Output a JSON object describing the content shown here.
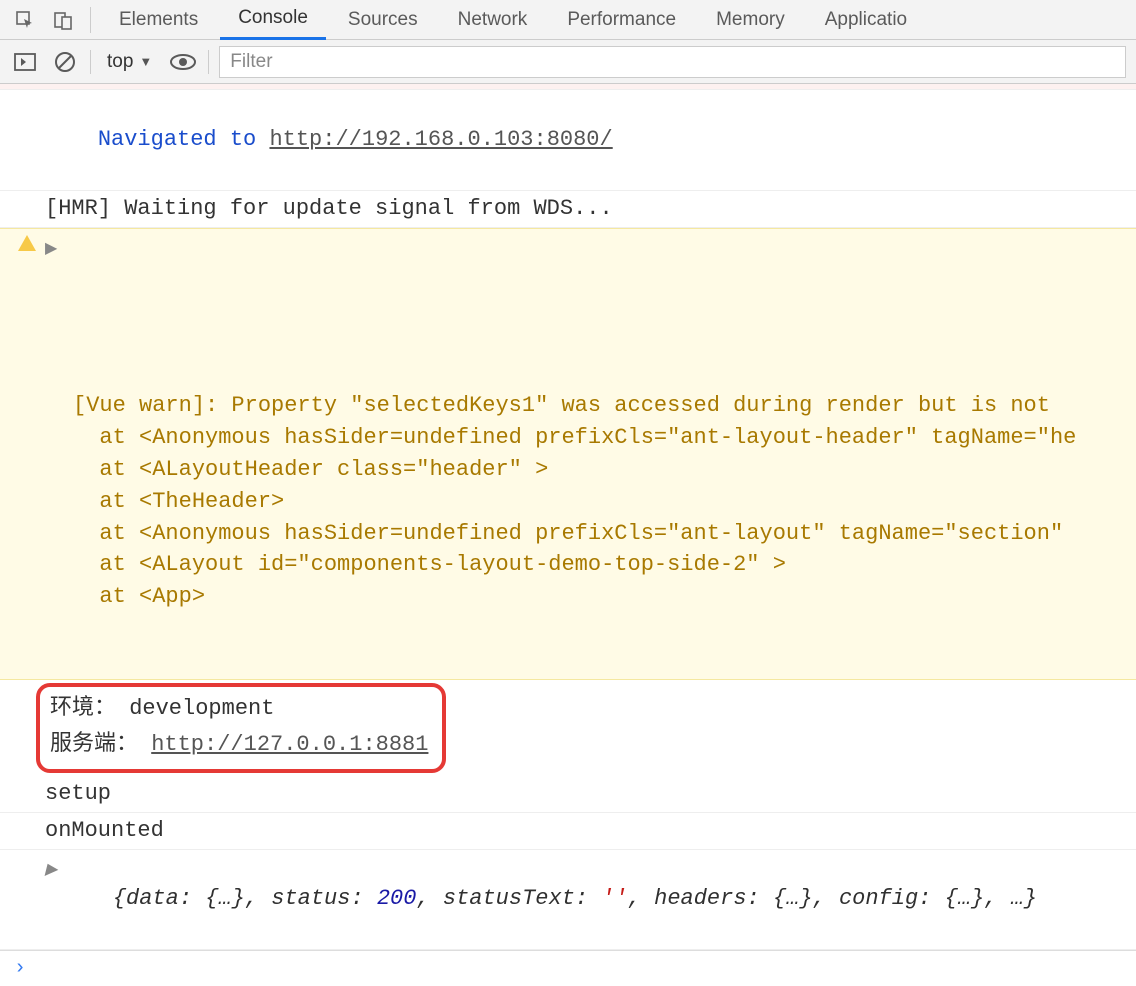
{
  "tabs": {
    "items": [
      "Elements",
      "Console",
      "Sources",
      "Network",
      "Performance",
      "Memory",
      "Applicatio"
    ],
    "active_index": 1
  },
  "toolbar": {
    "context": "top",
    "filter_placeholder": "Filter"
  },
  "logs": {
    "nav_prefix": "Navigated to ",
    "nav_url": "http://192.168.0.103:8080/",
    "hmr": "[HMR] Waiting for update signal from WDS...",
    "warn_l1": "[Vue warn]: Property \"selectedKeys1\" was accessed during render but is not",
    "warn_l2": "  at <Anonymous hasSider=undefined prefixCls=\"ant-layout-header\" tagName=\"he",
    "warn_l3": "  at <ALayoutHeader class=\"header\" >",
    "warn_l4": "  at <TheHeader>",
    "warn_l5": "  at <Anonymous hasSider=undefined prefixCls=\"ant-layout\" tagName=\"section\"",
    "warn_l6": "  at <ALayout id=\"components-layout-demo-top-side-2\" >",
    "warn_l7": "  at <App>",
    "env_label": "环境： ",
    "env_value": "development",
    "server_label": "服务端： ",
    "server_url": "http://127.0.0.1:8881",
    "setup": "setup",
    "onmounted": "onMounted",
    "obj_p1": "{data: {…}, status: ",
    "obj_status": "200",
    "obj_p2": ", statusText: ",
    "obj_stxt": "''",
    "obj_p3": ", headers: {…}, config: {…}, …}"
  },
  "prompt": "›"
}
